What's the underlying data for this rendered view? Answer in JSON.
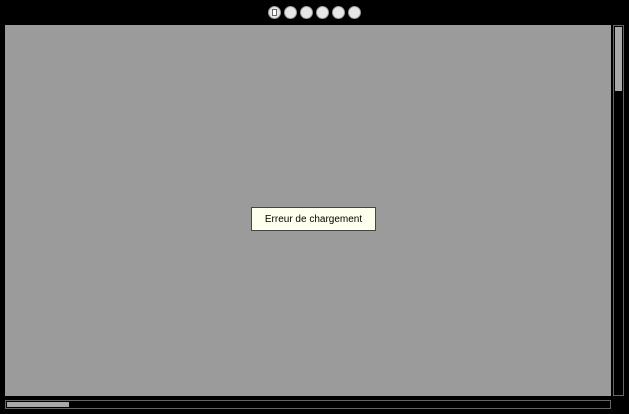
{
  "toolbar": {
    "buttons": [
      {
        "icon": "page-icon"
      },
      {
        "icon": "circle-button-icon"
      },
      {
        "icon": "circle-button-icon"
      },
      {
        "icon": "circle-button-icon"
      },
      {
        "icon": "circle-button-icon"
      },
      {
        "icon": "circle-button-icon"
      }
    ]
  },
  "viewport": {
    "background": "#9b9b9b",
    "error_message": "Erreur de chargement"
  },
  "colors": {
    "window_background": "#000000",
    "error_box_background": "#ffffee",
    "scrollbar_thumb": "#a8a8a8"
  }
}
